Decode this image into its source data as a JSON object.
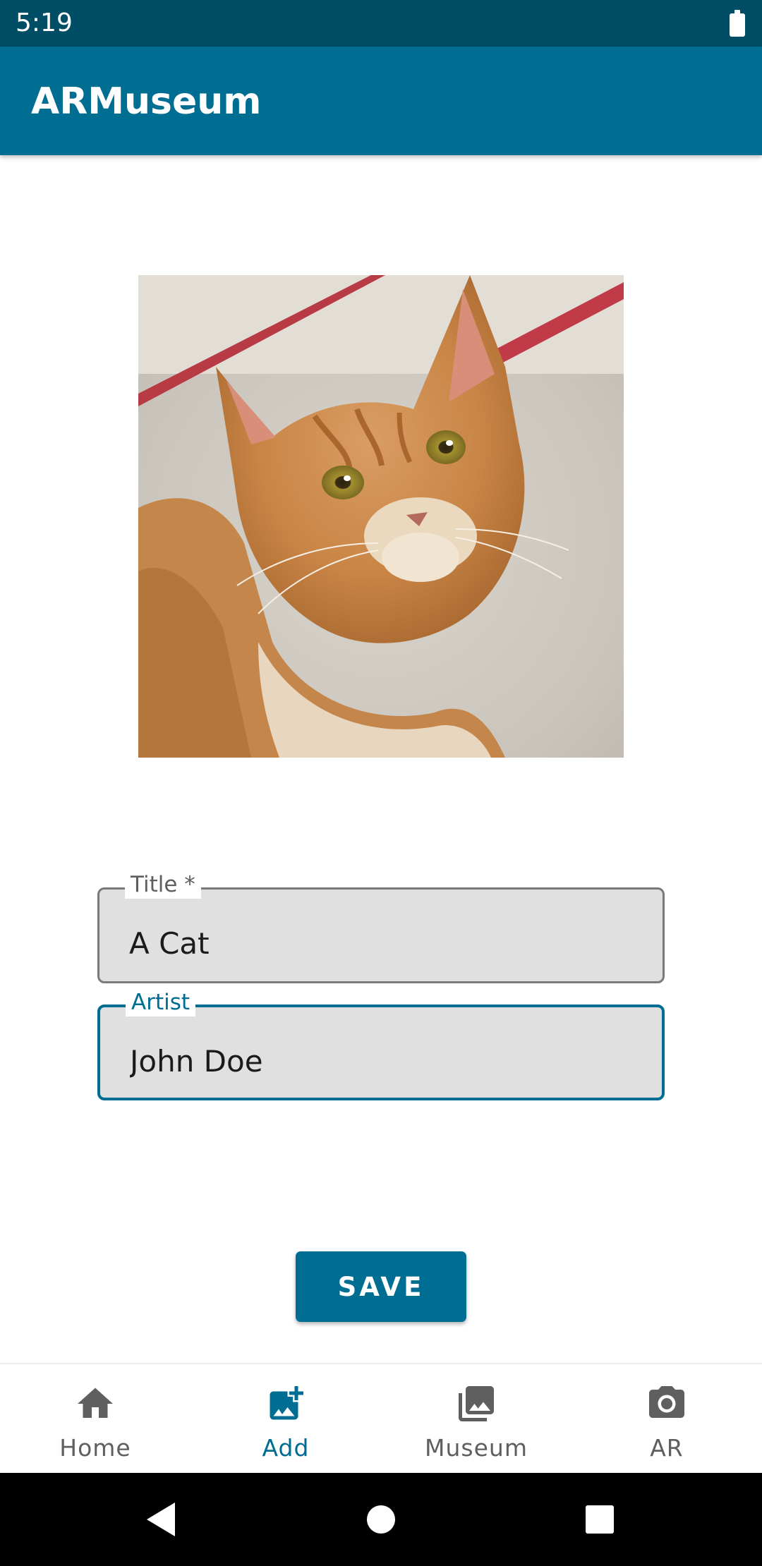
{
  "status_bar": {
    "time": "5:19"
  },
  "app_bar": {
    "title": "ARMuseum"
  },
  "form": {
    "title_field": {
      "label": "Title *",
      "value": "A Cat"
    },
    "artist_field": {
      "label": "Artist",
      "value": "John Doe"
    },
    "save_label": "SAVE"
  },
  "bottom_nav": {
    "items": [
      {
        "label": "Home",
        "icon": "home-icon",
        "active": false
      },
      {
        "label": "Add",
        "icon": "add-photo-icon",
        "active": true
      },
      {
        "label": "Museum",
        "icon": "photo-library-icon",
        "active": false
      },
      {
        "label": "AR",
        "icon": "camera-icon",
        "active": false
      }
    ]
  },
  "colors": {
    "primary": "#006e93",
    "status_bar": "#004d66",
    "field_fill": "#e0e0e0",
    "nav_inactive": "#5f5f5f"
  }
}
